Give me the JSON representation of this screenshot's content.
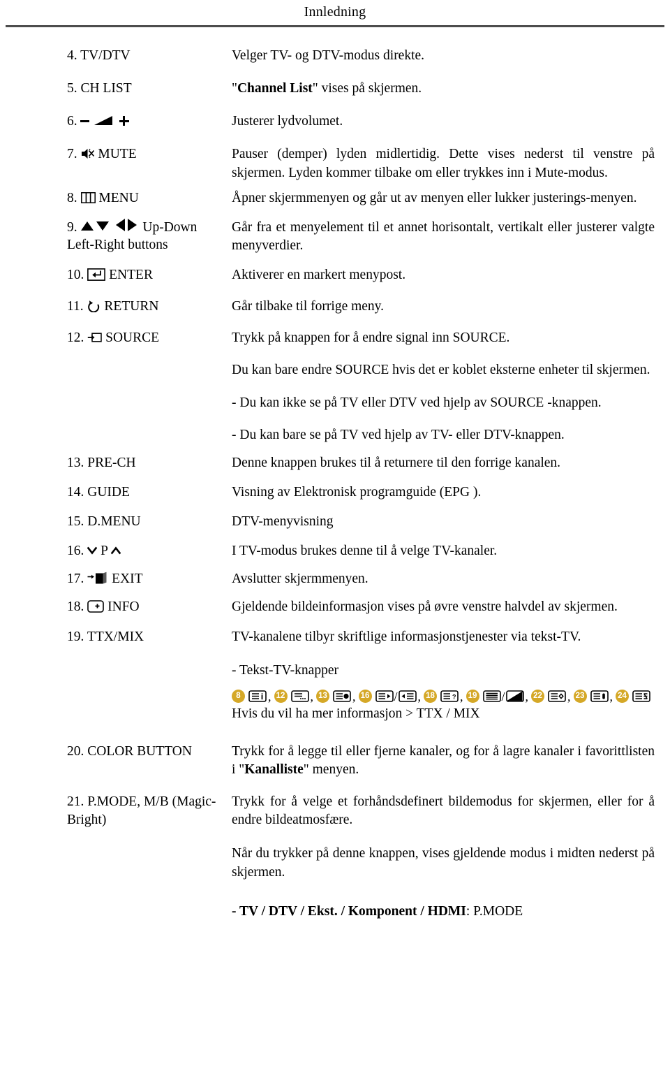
{
  "header": {
    "title": "Innledning"
  },
  "entries": [
    {
      "num": "4.",
      "label": "TV/DTV",
      "icon": null,
      "desc": [
        "Velger TV- og DTV-modus direkte."
      ]
    },
    {
      "num": "5.",
      "label": "CH LIST",
      "icon": null,
      "desc_html": "\"<b>Channel List</b>\" vises på skjermen."
    },
    {
      "num": "6.",
      "label": "",
      "icon": "volume-icon",
      "desc": [
        "Justerer lydvolumet."
      ]
    },
    {
      "num": "7.",
      "label": "MUTE",
      "icon": "mute-icon",
      "desc": [
        "Pauser (demper) lyden midlertidig. Dette vises nederst til venstre på skjermen. Lyden kommer tilbake om eller trykkes inn i Mute-modus."
      ]
    },
    {
      "num": "8.",
      "label": "MENU",
      "icon": "menu-icon",
      "desc": [
        "Åpner skjermmenyen og går ut av menyen eller lukker justerings-menyen."
      ]
    },
    {
      "num": "9.",
      "label": "Up-Down Left-Right buttons",
      "icon": "direction-arrows-icon",
      "desc": [
        "Går fra et menyelement til et annet horisontalt, vertikalt eller justerer valgte menyverdier."
      ]
    },
    {
      "num": "10.",
      "label": "ENTER",
      "icon": "enter-icon",
      "desc": [
        "Aktiverer en markert menypost."
      ]
    },
    {
      "num": "11.",
      "label": "RETURN",
      "icon": "return-icon",
      "desc": [
        "Går tilbake til forrige meny."
      ]
    },
    {
      "num": "12.",
      "label": "SOURCE",
      "icon": "source-icon",
      "desc": [
        "Trykk på knappen for å endre signal inn SOURCE.",
        "Du kan bare endre SOURCE hvis det er koblet eksterne enheter til skjermen.",
        "- Du kan ikke se på TV eller DTV ved hjelp av SOURCE -knappen.",
        "- Du kan bare se på TV ved hjelp av TV- eller DTV-knappen."
      ]
    },
    {
      "num": "13.",
      "label": "PRE-CH",
      "icon": null,
      "desc": [
        "Denne knappen brukes til å returnere til den forrige kanalen."
      ]
    },
    {
      "num": "14.",
      "label": "GUIDE",
      "icon": null,
      "desc": [
        "Visning av Elektronisk programguide (EPG )."
      ]
    },
    {
      "num": "15.",
      "label": "D.MENU",
      "icon": null,
      "desc": [
        "DTV-menyvisning"
      ]
    },
    {
      "num": "16.",
      "label": "P",
      "icon": "channel-updown-icon",
      "desc": [
        "I TV-modus brukes denne til å velge TV-kanaler."
      ]
    },
    {
      "num": "17.",
      "label": "EXIT",
      "icon": "exit-icon",
      "desc": [
        "Avslutter skjermmenyen."
      ]
    },
    {
      "num": "18.",
      "label": "INFO",
      "icon": "info-icon",
      "desc": [
        "Gjeldende bildeinformasjon vises på øvre venstre halvdel av skjermen."
      ]
    },
    {
      "num": "19.",
      "label": "TTX/MIX",
      "icon": null,
      "desc": [
        "TV-kanalene tilbyr skriftlige informasjonstjenester via tekst-TV."
      ],
      "subheading": "- Tekst-TV-knapper",
      "footnote": "Hvis du vil ha mer informasjon > TTX / MIX"
    },
    {
      "num": "20.",
      "label": "COLOR BUTTON",
      "icon": null,
      "desc_html": "Trykk for å legge til eller fjerne kanaler, og for å lagre kanaler i favorittlisten i \"<b>Kanalliste</b>\" menyen."
    },
    {
      "num": "21.",
      "label": "P.MODE, M/B (Magic-Bright)",
      "icon": null,
      "desc": [
        "Trykk for å velge et forhåndsdefinert bildemodus for skjermen, eller for å endre bildeatmosfære.",
        "Når du trykker på denne knappen, vises gjeldende modus i midten nederst på skjermen."
      ],
      "footer_html": "<b>- TV / DTV / Ekst. / Komponent / HDMI</b>: P.MODE"
    }
  ],
  "teletext_buttons": [
    {
      "number": "8",
      "icon": "ttx-index-icon"
    },
    {
      "number": "12",
      "icon": "ttx-sub-page-icon"
    },
    {
      "number": "13",
      "icon": "ttx-hold-icon"
    },
    {
      "number": "16",
      "icon": "ttx-next-page-icon",
      "icon2": "ttx-prev-page-icon"
    },
    {
      "number": "18",
      "icon": "ttx-reveal-icon"
    },
    {
      "number": "19",
      "icon": "ttx-mix-icon",
      "icon2": "ttx-cancel-icon"
    },
    {
      "number": "22",
      "icon": "ttx-size-icon"
    },
    {
      "number": "23",
      "icon": "ttx-store-icon"
    },
    {
      "number": "24",
      "icon": "ttx-list-icon"
    }
  ],
  "colors": {
    "badge_gold": "#d5a827",
    "rule_gray": "#4d4d4d",
    "text": "#000000"
  }
}
